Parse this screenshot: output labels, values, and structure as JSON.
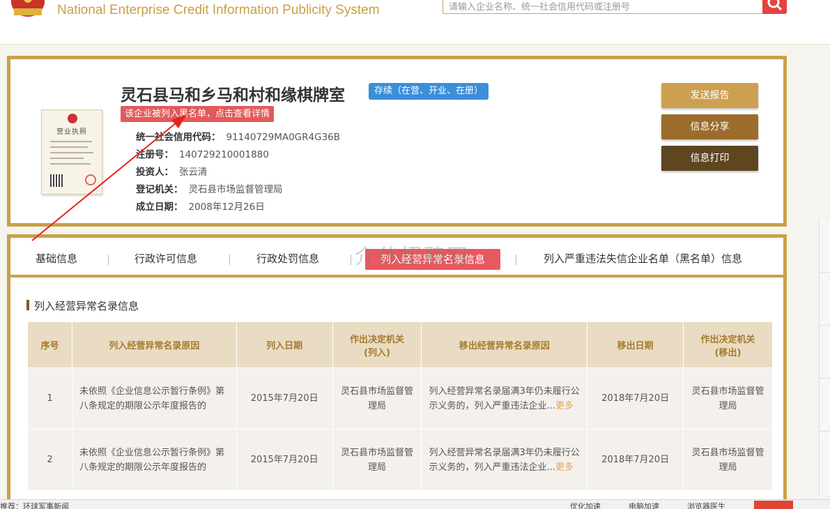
{
  "header": {
    "system_title": "National Enterprise Credit Information Publicity System",
    "search_placeholder": "请输入企业名称、统一社会信用代码或注册号"
  },
  "company": {
    "name": "灵石县马和乡马和村和缘棋牌室",
    "status": "存续（在营、开业、在册）",
    "blacklist_notice": "该企业被列入黑名单，点击查看详情",
    "license_title": "营业执照",
    "fields": [
      {
        "label": "统一社会信用代码：",
        "value": "91140729MA0GR4G36B"
      },
      {
        "label": "注册号：",
        "value": "140729210001880"
      },
      {
        "label": "投资人：",
        "value": "张云清"
      },
      {
        "label": "登记机关：",
        "value": "灵石县市场监督管理局"
      },
      {
        "label": "成立日期：",
        "value": "2008年12月26日"
      }
    ]
  },
  "actions": {
    "send_report": "发送报告",
    "share": "信息分享",
    "print": "信息打印"
  },
  "tabs": {
    "basic": "基础信息",
    "license": "行政许可信息",
    "penalty": "行政处罚信息",
    "abnormal": "列入经营异常名录信息",
    "blacklist": "列入严重违法失信企业名单（黑名单）信息"
  },
  "watermark": "介休招聘网",
  "section": {
    "title": "列入经营异常名录信息",
    "columns": [
      "序号",
      "列入经营异常名录原因",
      "列入日期",
      "作出决定机关\n(列入)",
      "移出经营异常名录原因",
      "移出日期",
      "作出决定机关\n(移出)"
    ],
    "rows": [
      {
        "no": "1",
        "reason_in": "未依照《企业信息公示暂行条例》第八条规定的期限公示年度报告的",
        "date_in": "2015年7月20日",
        "authority_in": "灵石县市场监督管理局",
        "reason_out": "列入经营异常名录届满3年仍未履行公示义务的，列入严重违法企业...",
        "more": "更多",
        "date_out": "2018年7月20日",
        "authority_out": "灵石县市场监督管理局"
      },
      {
        "no": "2",
        "reason_in": "未依照《企业信息公示暂行条例》第八条规定的期限公示年度报告的",
        "date_in": "2015年7月20日",
        "authority_in": "灵石县市场监督管理局",
        "reason_out": "列入经营异常名录届满3年仍未履行公示义务的，列入严重违法企业...",
        "more": "更多",
        "date_out": "2018年7月20日",
        "authority_out": "灵石县市场监督管理局"
      }
    ]
  },
  "statusbar": {
    "news": "推荐：环球军事新闻",
    "optimize": "优化加速",
    "pc_speed": "电脑加速",
    "browser_doctor": "浏览器医生"
  },
  "colors": {
    "gold": "#c9a04a",
    "status_blue": "#3a8fd9",
    "alert_red": "#e25a5a"
  }
}
